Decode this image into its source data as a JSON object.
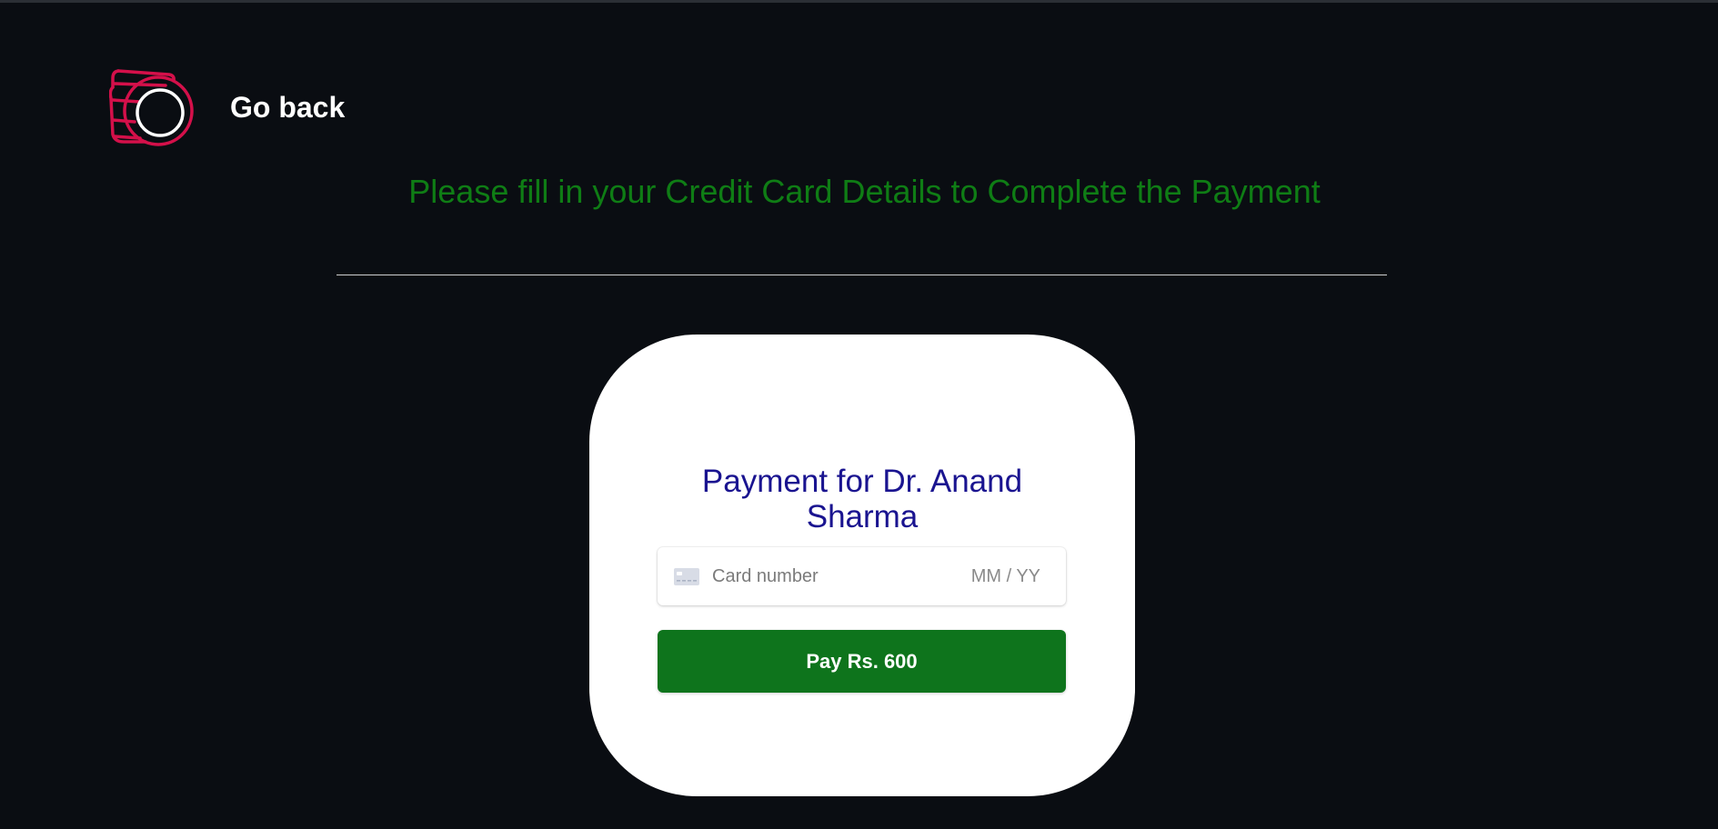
{
  "header": {
    "logo_icon": "hand-coin-logo-icon",
    "go_back_label": "Go back"
  },
  "headline": "Please fill in your Credit Card Details to Complete the Payment",
  "payment_card": {
    "title_line1": "Payment for Dr. Anand",
    "title_line2": "Sharma",
    "card_input": {
      "icon": "credit-card-icon",
      "card_number_placeholder": "Card number",
      "expiry_placeholder": "MM / YY"
    },
    "pay_button_label": "Pay Rs. 600"
  },
  "colors": {
    "background": "#0a0d12",
    "headline": "#0f7d15",
    "logo": "#d4104a",
    "card_title": "#1a1490",
    "pay_button": "#0e741c"
  }
}
